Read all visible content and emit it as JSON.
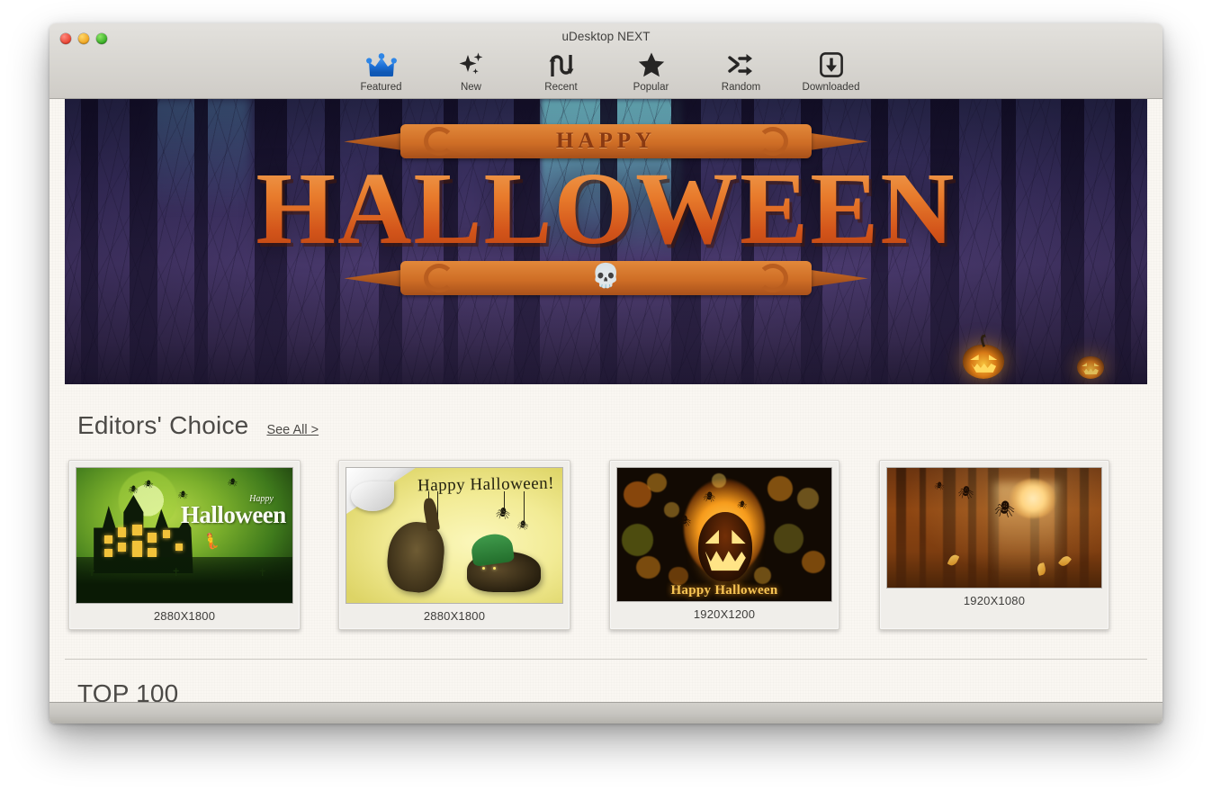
{
  "window": {
    "title": "uDesktop NEXT",
    "traffic_lights": [
      {
        "name": "close",
        "color": "#e8402f"
      },
      {
        "name": "minimize",
        "color": "#efa31d"
      },
      {
        "name": "zoom",
        "color": "#34ab23"
      }
    ]
  },
  "toolbar": {
    "items": [
      {
        "label": "Featured",
        "icon": "crown-icon",
        "selected": true,
        "accent": "#1b6fd6"
      },
      {
        "label": "New",
        "icon": "sparkle-icon",
        "selected": false,
        "accent": "#262524"
      },
      {
        "label": "Recent",
        "icon": "s-curve-arrow-icon",
        "selected": false,
        "accent": "#262524"
      },
      {
        "label": "Popular",
        "icon": "star-icon",
        "selected": false,
        "accent": "#262524"
      },
      {
        "label": "Random",
        "icon": "shuffle-icon",
        "selected": false,
        "accent": "#262524"
      },
      {
        "label": "Downloaded",
        "icon": "download-box-icon",
        "selected": false,
        "accent": "#262524"
      }
    ]
  },
  "hero": {
    "name": "happy-halloween-banner",
    "top_text": "HAPPY",
    "main_text": "HALLOWEEN",
    "scene": "dark purple forest with glowing jack-o-lanterns",
    "pumpkin_count": 2
  },
  "editors_choice": {
    "title": "Editors' Choice",
    "see_all_label": "See All >",
    "items": [
      {
        "resolution": "2880X1800",
        "art": "haunted-house-green",
        "caption_small": "Happy",
        "caption_large": "Halloween"
      },
      {
        "resolution": "2880X1800",
        "art": "cats-yellow-paper",
        "caption": "Happy Halloween!"
      },
      {
        "resolution": "1920X1200",
        "art": "bokeh-pumpkin-face",
        "caption": "Happy Halloween"
      },
      {
        "resolution": "1920X1080",
        "art": "orange-forest-bats",
        "caption": ""
      }
    ]
  },
  "top_section": {
    "title": "TOP 100"
  },
  "colors": {
    "window_chrome": "#d9d7d2",
    "content_background": "#faf7f2",
    "text_primary": "#4c4a47",
    "featured_accent": "#1b6fd6",
    "halloween_orange": "#e87b2c"
  }
}
